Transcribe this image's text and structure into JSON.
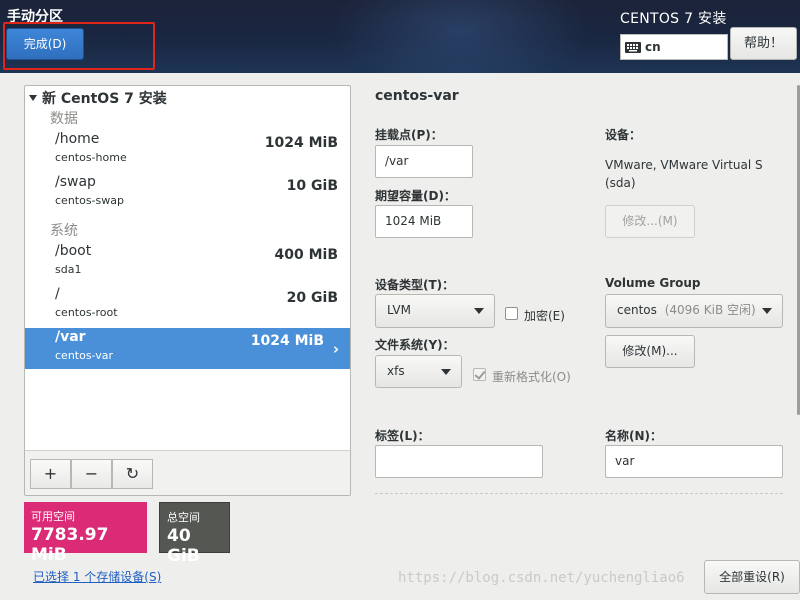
{
  "header": {
    "page_title": "手动分区",
    "done_button": "完成(D)",
    "product_title": "CENTOS 7 安装",
    "keyboard_layout": "cn",
    "help_button": "帮助！"
  },
  "partition_tree": {
    "root_label": "新 CentOS 7 安装",
    "sections": [
      {
        "label": "数据",
        "mounts": [
          {
            "mount_point": "/home",
            "device": "centos-home",
            "size": "1024 MiB"
          },
          {
            "mount_point": "/swap",
            "device": "centos-swap",
            "size": "10 GiB"
          }
        ]
      },
      {
        "label": "系统",
        "mounts": [
          {
            "mount_point": "/boot",
            "device": "sda1",
            "size": "400 MiB"
          },
          {
            "mount_point": "/",
            "device": "centos-root",
            "size": "20 GiB"
          },
          {
            "mount_point": "/var",
            "device": "centos-var",
            "size": "1024 MiB"
          }
        ]
      }
    ],
    "selected_mount": "/var",
    "toolbar": {
      "add": "+",
      "remove": "−",
      "refresh": "↻"
    }
  },
  "space": {
    "available_label": "可用空间",
    "available_value": "7783.97 MiB",
    "total_label": "总空间",
    "total_value": "40 GiB"
  },
  "storage_link": {
    "prefix": "已选择 ",
    "count": "1",
    "suffix": " 个存储设备(S)"
  },
  "details": {
    "title": "centos-var",
    "mount_point_label": "挂载点(P)：",
    "mount_point_value": "/var",
    "desired_capacity_label": "期望容量(D)：",
    "desired_capacity_value": "1024 MiB",
    "device_label": "设备：",
    "device_line1": "VMware, VMware Virtual S",
    "device_line2": "(sda)",
    "device_modify_button": "修改...(M)",
    "device_type_label": "设备类型(T)：",
    "device_type_value": "LVM",
    "encrypt_label": "加密(E)",
    "encrypt_checked": false,
    "filesystem_label": "文件系统(Y)：",
    "filesystem_value": "xfs",
    "reformat_label": "重新格式化(O)",
    "reformat_checked": true,
    "volume_group_label": "Volume Group",
    "volume_group_name": "centos",
    "volume_group_free": "(4096 KiB 空闲)",
    "volume_group_modify_button": "修改(M)...",
    "label_field_label": "标签(L)：",
    "label_field_value": "",
    "name_label": "名称(N)：",
    "name_value": "var",
    "reset_all_button": "全部重设(R)"
  },
  "watermark": "https://blog.csdn.net/yuchengliao6"
}
